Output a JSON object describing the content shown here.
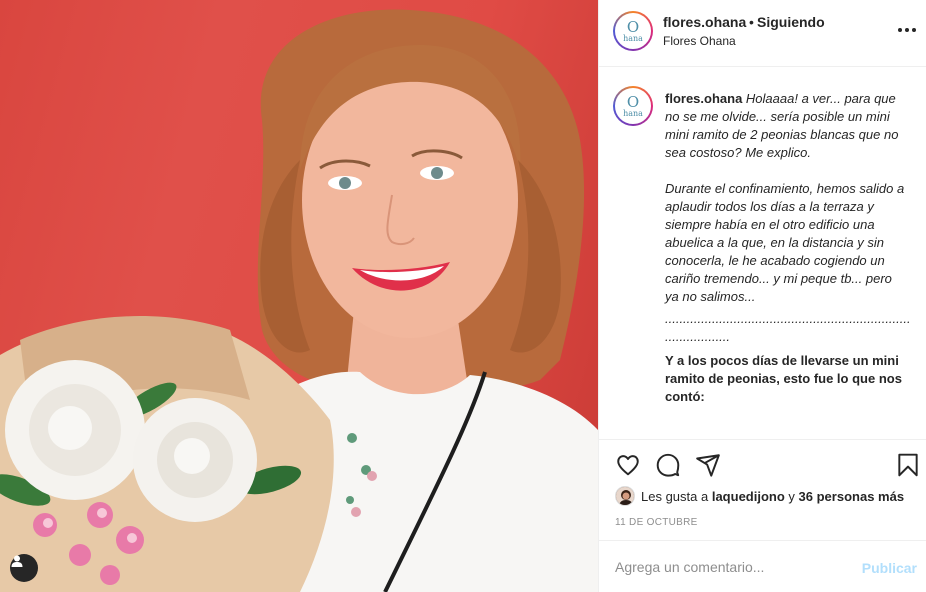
{
  "header": {
    "username": "flores.ohana",
    "separator": "•",
    "follow_status": "Siguiendo",
    "subtitle": "Flores Ohana",
    "avatar_logo_big": "O",
    "avatar_logo_small": "hana",
    "more_icon": "more-horizontal-icon"
  },
  "caption": {
    "username": "flores.ohana",
    "intro": "Holaaaa! a ver... para que no se me olvide... sería posible un mini mini ramito de 2 peonias blancas que no sea costoso? Me explico.",
    "paragraph": "Durante el confinamiento, hemos salido a aplaudir todos los días a la terraza y siempre había en el otro edificio una abuelica a la que, en la distancia y sin conocerla, le he acabado cogiendo un cariño tremendo... y mi peque tb... pero ya no salimos...",
    "dots_1": "...............................................................................",
    "dots_2": "..................",
    "bold_text": "Y a los pocos días de llevarse un mini ramito de peonias, esto fue lo que nos contó:"
  },
  "actions": {
    "like_icon": "heart-icon",
    "comment_icon": "comment-icon",
    "share_icon": "paper-plane-icon",
    "save_icon": "bookmark-icon"
  },
  "likes": {
    "prefix": "Les gusta a",
    "user": "laquedijono",
    "connector": "y",
    "others": "36 personas más"
  },
  "date": "11 DE OCTUBRE",
  "comment_box": {
    "placeholder": "Agrega un comentario...",
    "publish_label": "Publicar"
  },
  "photo": {
    "tag_icon": "user-tag-icon"
  },
  "colors": {
    "background_red": "#e04b45",
    "publish_blue": "#b2dffc",
    "muted_grey": "#8e8e8e",
    "text": "#262626"
  }
}
